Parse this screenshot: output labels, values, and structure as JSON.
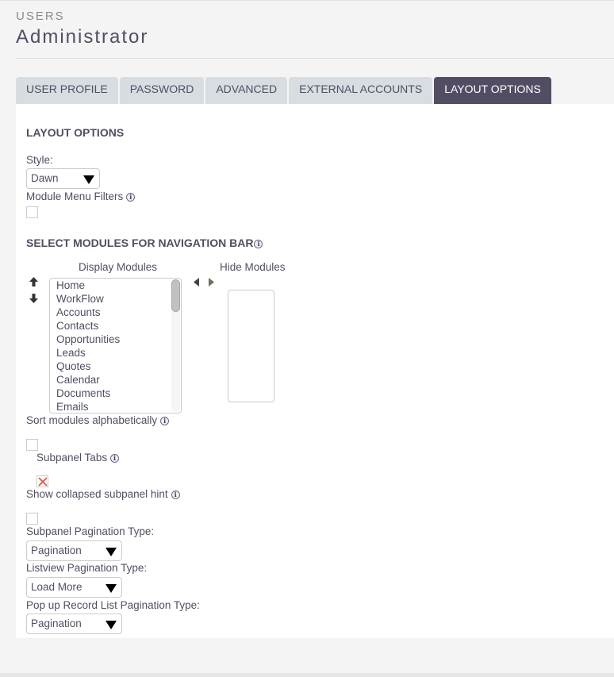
{
  "header": {
    "module_name": "USERS",
    "title": "Administrator"
  },
  "tabs": [
    {
      "label": "USER PROFILE",
      "active": false
    },
    {
      "label": "PASSWORD",
      "active": false
    },
    {
      "label": "ADVANCED",
      "active": false
    },
    {
      "label": "EXTERNAL ACCOUNTS",
      "active": false
    },
    {
      "label": "LAYOUT OPTIONS",
      "active": true
    }
  ],
  "layout_options": {
    "heading": "LAYOUT OPTIONS",
    "style_label": "Style:",
    "style_value": "Dawn",
    "module_menu_filters_label": "Module Menu Filters",
    "module_menu_filters_checked": false
  },
  "navigation": {
    "heading": "SELECT MODULES FOR NAVIGATION BAR",
    "display_label": "Display Modules",
    "hide_label": "Hide Modules",
    "display_modules": [
      "Home",
      "WorkFlow",
      "Accounts",
      "Contacts",
      "Opportunities",
      "Leads",
      "Quotes",
      "Calendar",
      "Documents",
      "Emails"
    ],
    "hide_modules": [],
    "icons": {
      "move_up": "arrow-up-icon",
      "move_down": "arrow-down-icon",
      "move_left": "triangle-left-icon",
      "move_right": "triangle-right-icon",
      "info": "info-icon"
    }
  },
  "options": {
    "sort_alpha_label": "Sort modules alphabetically",
    "sort_alpha_checked": false,
    "subpanel_tabs_label": "Subpanel Tabs",
    "subpanel_tabs_checked": true,
    "collapsed_hint_label": "Show collapsed subpanel hint",
    "collapsed_hint_checked": false,
    "subpanel_pagination_label": "Subpanel Pagination Type:",
    "subpanel_pagination_value": "Pagination",
    "listview_pagination_label": "Listview Pagination Type:",
    "listview_pagination_value": "Load More",
    "popup_pagination_label": "Pop up Record List Pagination Type:",
    "popup_pagination_value": "Pagination"
  },
  "colors": {
    "accent": "#534d64",
    "tab_inactive": "#d8dde1",
    "checked_mark": "#e8604c",
    "background": "#f4f4f4"
  }
}
